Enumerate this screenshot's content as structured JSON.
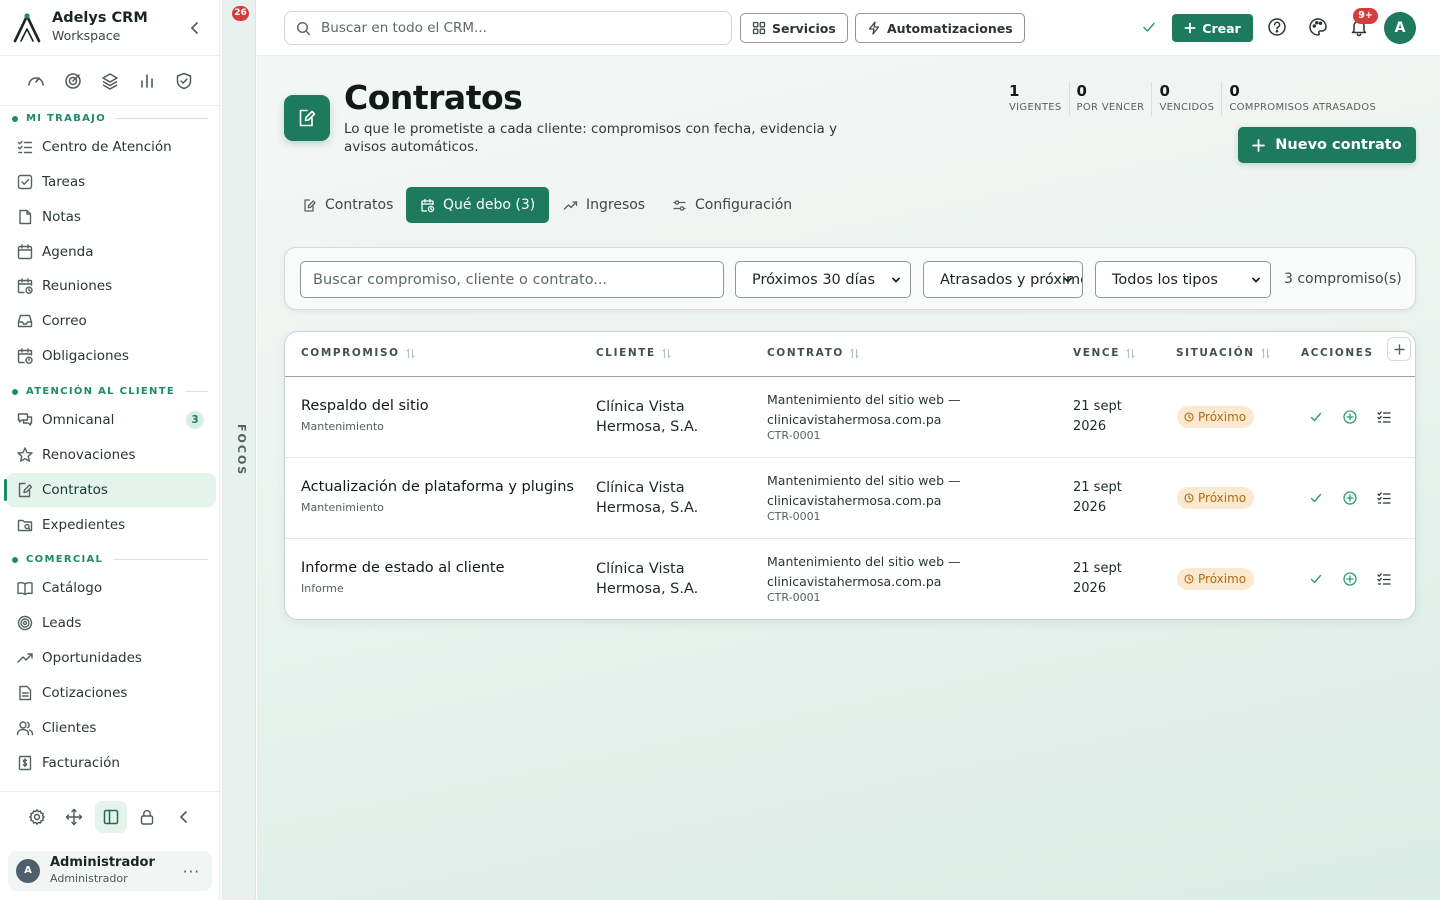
{
  "brand": {
    "name": "Adelys CRM",
    "subtitle": "Workspace"
  },
  "quick_icons": [
    "gauge-icon",
    "target-icon",
    "layers-icon",
    "bar-chart-icon",
    "shield-check-icon"
  ],
  "sidebar": {
    "sections": [
      {
        "title": "MI TRABAJO",
        "items": [
          {
            "label": "Centro de Atención",
            "icon": "list-checks-icon"
          },
          {
            "label": "Tareas",
            "icon": "checkbox-icon"
          },
          {
            "label": "Notas",
            "icon": "note-icon"
          },
          {
            "label": "Agenda",
            "icon": "calendar-icon"
          },
          {
            "label": "Reuniones",
            "icon": "calendar-clock-icon"
          },
          {
            "label": "Correo",
            "icon": "inbox-icon"
          },
          {
            "label": "Obligaciones",
            "icon": "calendar-alert-icon"
          }
        ]
      },
      {
        "title": "ATENCIÓN AL CLIENTE",
        "items": [
          {
            "label": "Omnicanal",
            "icon": "chat-icon",
            "count": "3"
          },
          {
            "label": "Renovaciones",
            "icon": "star-icon"
          },
          {
            "label": "Contratos",
            "icon": "contract-icon",
            "active": true
          },
          {
            "label": "Expedientes",
            "icon": "folder-icon"
          }
        ]
      },
      {
        "title": "COMERCIAL",
        "items": [
          {
            "label": "Catálogo",
            "icon": "book-icon"
          },
          {
            "label": "Leads",
            "icon": "target-icon"
          },
          {
            "label": "Oportunidades",
            "icon": "trend-icon"
          },
          {
            "label": "Cotizaciones",
            "icon": "document-icon"
          },
          {
            "label": "Clientes",
            "icon": "users-icon"
          },
          {
            "label": "Facturación",
            "icon": "invoice-icon"
          }
        ]
      }
    ]
  },
  "bottom_tools": [
    "settings-icon",
    "move-icon",
    "sidebar-panel-icon",
    "lock-icon",
    "chevron-left-icon"
  ],
  "user": {
    "initial": "A",
    "name": "Administrador",
    "role": "Administrador"
  },
  "focos": {
    "label": "FOCOS",
    "badge": "26"
  },
  "topbar": {
    "search_placeholder": "Buscar en todo el CRM...",
    "services_label": "Servicios",
    "automations_label": "Automatizaciones",
    "create_label": "Crear",
    "notifications_badge": "9+",
    "avatar_initial": "A"
  },
  "page": {
    "title": "Contratos",
    "description": "Lo que le prometiste a cada cliente: compromisos con fecha, evidencia y avisos automáticos.",
    "stats": [
      {
        "value": "1",
        "label": "VIGENTES"
      },
      {
        "value": "0",
        "label": "POR VENCER"
      },
      {
        "value": "0",
        "label": "VENCIDOS"
      },
      {
        "value": "0",
        "label": "COMPROMISOS ATRASADOS"
      }
    ],
    "new_button": "Nuevo contrato"
  },
  "tabs": [
    {
      "label": "Contratos",
      "icon": "contract-icon"
    },
    {
      "label": "Qué debo (3)",
      "icon": "calendar-clock-icon",
      "active": true
    },
    {
      "label": "Ingresos",
      "icon": "trend-icon"
    },
    {
      "label": "Configuración",
      "icon": "sliders-icon"
    }
  ],
  "filters": {
    "search_placeholder": "Buscar compromiso, cliente o contrato...",
    "period": "Próximos 30 días",
    "status": "Atrasados y próximos",
    "type": "Todos los tipos",
    "count_text": "3 compromiso(s)"
  },
  "table": {
    "headers": {
      "compromiso": "COMPROMISO",
      "cliente": "CLIENTE",
      "contrato": "CONTRATO",
      "vence": "VENCE",
      "situacion": "SITUACIÓN",
      "acciones": "ACCIONES"
    },
    "rows": [
      {
        "title": "Respaldo del sitio",
        "category": "Mantenimiento",
        "client": "Clínica Vista Hermosa, S.A.",
        "contract": "Mantenimiento del sitio web — clinicavistahermosa.com.pa",
        "code": "CTR-0001",
        "due": "21 sept 2026",
        "status": "Próximo"
      },
      {
        "title": "Actualización de plataforma y plugins",
        "category": "Mantenimiento",
        "client": "Clínica Vista Hermosa, S.A.",
        "contract": "Mantenimiento del sitio web — clinicavistahermosa.com.pa",
        "code": "CTR-0001",
        "due": "21 sept 2026",
        "status": "Próximo"
      },
      {
        "title": "Informe de estado al cliente",
        "category": "Informe",
        "client": "Clínica Vista Hermosa, S.A.",
        "contract": "Mantenimiento del sitio web — clinicavistahermosa.com.pa",
        "code": "CTR-0001",
        "due": "21 sept 2026",
        "status": "Próximo"
      }
    ]
  },
  "colors": {
    "primary": "#1e7a5c",
    "accent": "#1e8a6a",
    "warning_bg": "#fbe9cf",
    "warning_text": "#b06a12",
    "danger": "#d43d3d"
  }
}
